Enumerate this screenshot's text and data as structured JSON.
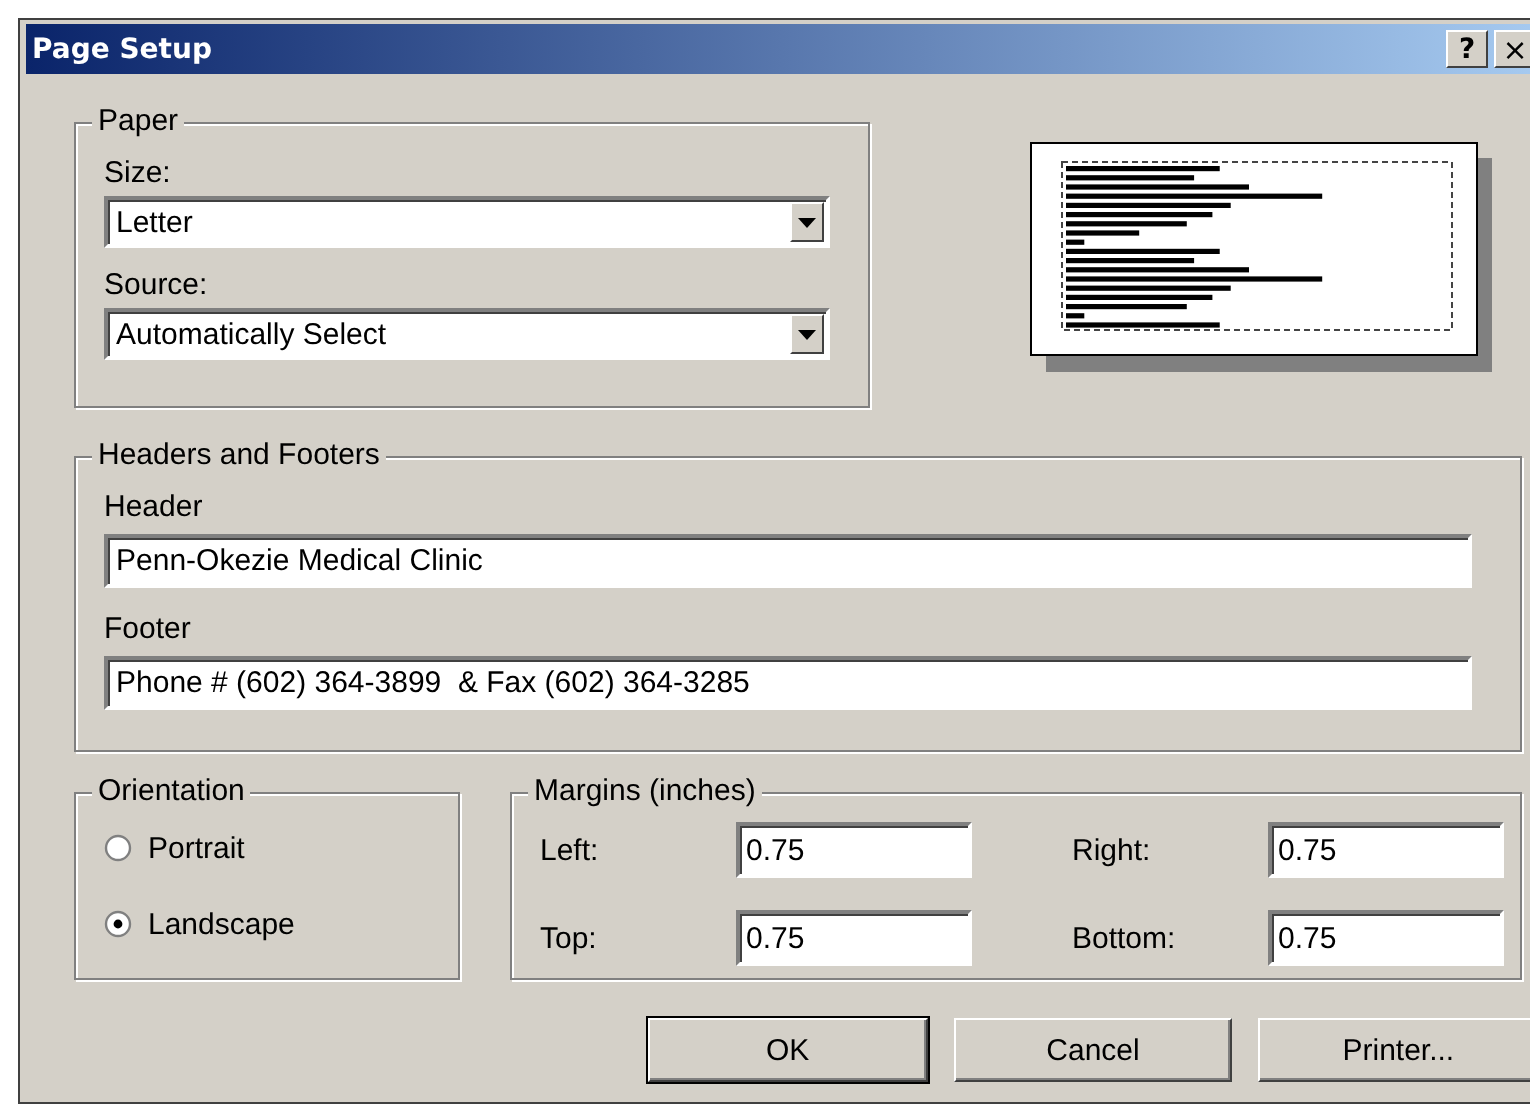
{
  "window": {
    "title": "Page Setup",
    "title_buttons": [
      {
        "kind": "help",
        "label": "?"
      },
      {
        "kind": "close",
        "label": "×"
      }
    ]
  },
  "paper": {
    "legend": "Paper",
    "size": {
      "label": "Size:",
      "value": "Letter"
    },
    "source": {
      "label": "Source:",
      "value": "Automatically Select"
    }
  },
  "headers_footers": {
    "legend": "Headers and Footers",
    "header": {
      "label": "Header",
      "value": "Penn-Okezie Medical Clinic"
    },
    "footer": {
      "label": "Footer",
      "value": "Phone # (602) 364-3899  & Fax (602) 364-3285"
    }
  },
  "orientation": {
    "legend": "Orientation",
    "options": [
      {
        "label": "Portrait",
        "selected": false
      },
      {
        "label": "Landscape",
        "selected": true
      }
    ]
  },
  "margins": {
    "legend": "Margins (inches)",
    "fields": [
      {
        "label": "Left:",
        "value": "0.75"
      },
      {
        "label": "Right:",
        "value": "0.75"
      },
      {
        "label": "Top:",
        "value": "0.75"
      },
      {
        "label": "Bottom:",
        "value": "0.75"
      }
    ]
  },
  "buttons": [
    {
      "label": "OK",
      "default": true
    },
    {
      "label": "Cancel",
      "default": false
    },
    {
      "label": "Printer...",
      "default": false
    }
  ]
}
